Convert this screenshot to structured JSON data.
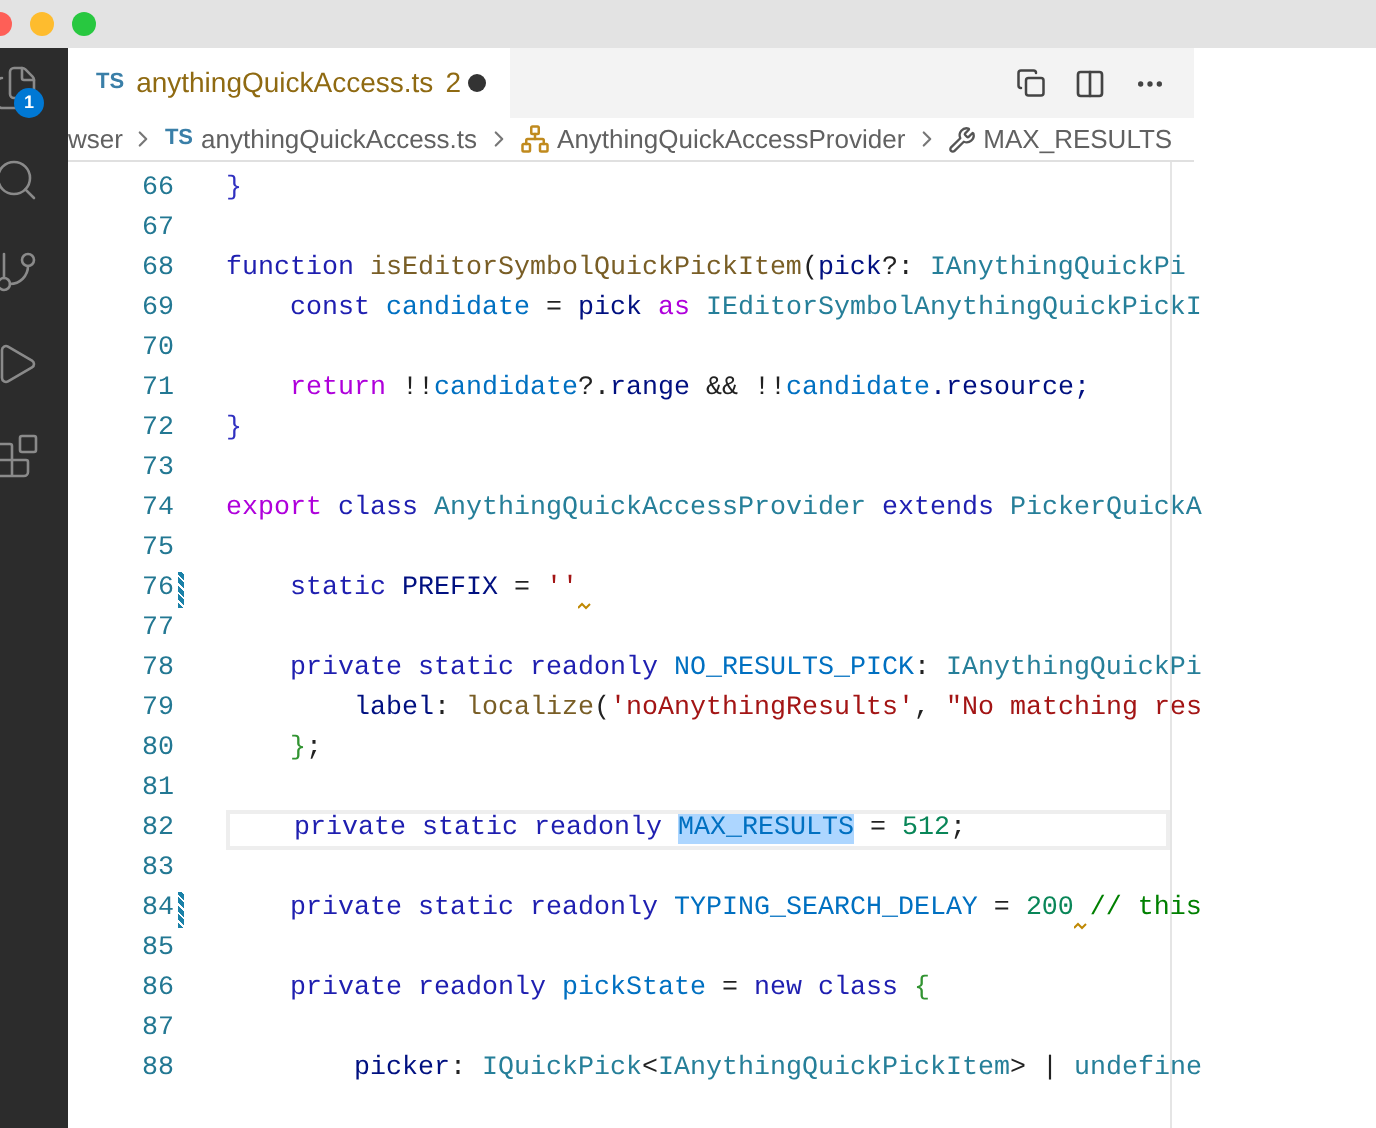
{
  "activity_bar": {
    "items": [
      {
        "kind": "files",
        "badge": "1"
      },
      {
        "kind": "search"
      },
      {
        "kind": "source-control"
      },
      {
        "kind": "run"
      },
      {
        "kind": "extensions"
      }
    ]
  },
  "tab": {
    "lang": "TS",
    "title": "anythingQuickAccess.ts",
    "problems": "2",
    "dirty": true,
    "selected": true
  },
  "breadcrumbs": [
    {
      "kind": "folder",
      "label": "wser"
    },
    {
      "kind": "file",
      "lang": "TS",
      "label": "anythingQuickAccess.ts"
    },
    {
      "kind": "class",
      "label": "AnythingQuickAccessProvider"
    },
    {
      "kind": "field",
      "label": "MAX_RESULTS"
    }
  ],
  "lines": [
    {
      "number": "66",
      "tokens": [
        {
          "text": "}",
          "kind": "punct"
        }
      ]
    },
    {
      "number": "67"
    },
    {
      "number": "68",
      "tokens": [
        {
          "text": "function ",
          "kind": "keyword"
        },
        {
          "text": "isEditorSymbolQuickPickItem",
          "kind": "function"
        },
        {
          "text": "(",
          "kind": "plain"
        },
        {
          "text": "pick",
          "kind": "param"
        },
        {
          "text": "?: ",
          "kind": "plain"
        },
        {
          "text": "IAnythingQuickPi",
          "kind": "type"
        }
      ]
    },
    {
      "number": "69",
      "tokens": [
        {
          "text": "    const ",
          "kind": "keyword"
        },
        {
          "text": "candidate",
          "kind": "variable"
        },
        {
          "text": " = ",
          "kind": "plain"
        },
        {
          "text": "pick",
          "kind": "param"
        },
        {
          "text": " as ",
          "kind": "control"
        },
        {
          "text": "IEditorSymbolAnythingQuickPickI",
          "kind": "type"
        }
      ]
    },
    {
      "number": "70"
    },
    {
      "number": "71",
      "tokens": [
        {
          "text": "    return ",
          "kind": "control"
        },
        {
          "text": "!!",
          "kind": "plain"
        },
        {
          "text": "candidate",
          "kind": "variable"
        },
        {
          "text": "?.",
          "kind": "plain"
        },
        {
          "text": "range",
          "kind": "param"
        },
        {
          "text": " && ",
          "kind": "plain"
        },
        {
          "text": "!!",
          "kind": "plain"
        },
        {
          "text": "candidate",
          "kind": "variable"
        },
        {
          "text": ".resource;",
          "kind": "param"
        }
      ]
    },
    {
      "number": "72",
      "tokens": [
        {
          "text": "}",
          "kind": "punct"
        }
      ]
    },
    {
      "number": "73"
    },
    {
      "number": "74",
      "tokens": [
        {
          "text": "export ",
          "kind": "control"
        },
        {
          "text": "class ",
          "kind": "keyword"
        },
        {
          "text": "AnythingQuickAccessProvider ",
          "kind": "type"
        },
        {
          "text": "extends ",
          "kind": "keyword"
        },
        {
          "text": "PickerQuickA",
          "kind": "type"
        }
      ]
    },
    {
      "number": "75"
    },
    {
      "number": "76",
      "modified": true,
      "tokens": [
        {
          "text": "    static ",
          "kind": "keyword"
        },
        {
          "text": "PREFIX",
          "kind": "param"
        },
        {
          "text": " = ",
          "kind": "plain"
        },
        {
          "text": "''",
          "kind": "string",
          "squiggle": true
        }
      ]
    },
    {
      "number": "77"
    },
    {
      "number": "78",
      "tokens": [
        {
          "text": "    private static readonly ",
          "kind": "keyword"
        },
        {
          "text": "NO_RESULTS_PICK",
          "kind": "variable"
        },
        {
          "text": ": ",
          "kind": "plain"
        },
        {
          "text": "IAnythingQuickPi",
          "kind": "type"
        }
      ]
    },
    {
      "number": "79",
      "tokens": [
        {
          "text": "        label",
          "kind": "param"
        },
        {
          "text": ": ",
          "kind": "plain"
        },
        {
          "text": "localize",
          "kind": "function"
        },
        {
          "text": "(",
          "kind": "plain"
        },
        {
          "text": "'noAnythingResults'",
          "kind": "string"
        },
        {
          "text": ", ",
          "kind": "plain"
        },
        {
          "text": "\"No matching res",
          "kind": "string"
        }
      ]
    },
    {
      "number": "80",
      "tokens": [
        {
          "text": "    }",
          "kind": "bracket"
        },
        {
          "text": ";",
          "kind": "plain"
        }
      ]
    },
    {
      "number": "81"
    },
    {
      "number": "82",
      "current": true,
      "tokens": [
        {
          "text": "    private static readonly ",
          "kind": "keyword"
        },
        {
          "text": "MAX_RESULTS",
          "kind": "variable",
          "selected": true
        },
        {
          "text": " = ",
          "kind": "plain"
        },
        {
          "text": "512",
          "kind": "number"
        },
        {
          "text": ";",
          "kind": "plain"
        }
      ]
    },
    {
      "number": "83"
    },
    {
      "number": "84",
      "modified": true,
      "tokens": [
        {
          "text": "    private static readonly ",
          "kind": "keyword"
        },
        {
          "text": "TYPING_SEARCH_DELAY",
          "kind": "variable"
        },
        {
          "text": " = ",
          "kind": "plain"
        },
        {
          "text": "200",
          "kind": "number",
          "squiggle": true
        },
        {
          "text": " // this",
          "kind": "comment"
        }
      ]
    },
    {
      "number": "85"
    },
    {
      "number": "86",
      "tokens": [
        {
          "text": "    private readonly ",
          "kind": "keyword"
        },
        {
          "text": "pickState",
          "kind": "variable"
        },
        {
          "text": " = ",
          "kind": "plain"
        },
        {
          "text": "new class ",
          "kind": "keyword"
        },
        {
          "text": "{",
          "kind": "bracket"
        }
      ]
    },
    {
      "number": "87"
    },
    {
      "number": "88",
      "tokens": [
        {
          "text": "        picker",
          "kind": "param"
        },
        {
          "text": ": ",
          "kind": "plain"
        },
        {
          "text": "IQuickPick",
          "kind": "type"
        },
        {
          "text": "<",
          "kind": "plain"
        },
        {
          "text": "IAnythingQuickPickItem",
          "kind": "type"
        },
        {
          "text": "> | ",
          "kind": "plain"
        },
        {
          "text": "undefine",
          "kind": "type"
        }
      ]
    }
  ]
}
